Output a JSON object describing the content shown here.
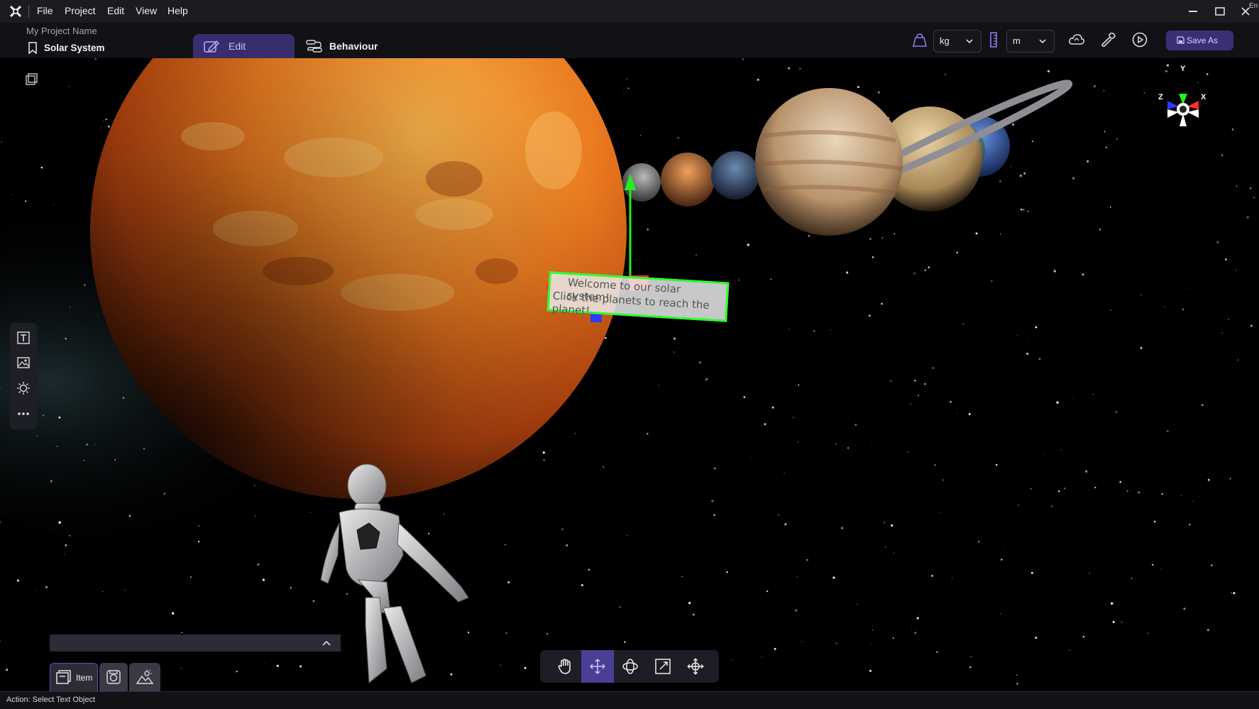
{
  "menu": [
    "File",
    "Project",
    "Edit",
    "View",
    "Help"
  ],
  "header": {
    "project_name": "My Project Name",
    "scene_name": "Solar System",
    "tabs": [
      {
        "label": "Edit",
        "active": true
      },
      {
        "label": "Behaviour",
        "active": false
      }
    ],
    "mass_unit": "kg",
    "length_unit": "m",
    "save_label": "Save As",
    "corner_text": "En"
  },
  "scene": {
    "text_line1": "Welcome to our solar system!",
    "text_line2": "Click the planets to reach the planet!",
    "gizmo": {
      "y": "Y",
      "x": "X",
      "z": "Z"
    }
  },
  "bottom": {
    "item_tab": "Item"
  },
  "status": "Action: Select Text Object",
  "colors": {
    "accent": "#4a3f95",
    "selection": "#2cff2c",
    "axis_x": "#ff3030",
    "axis_y": "#22ee22",
    "axis_z": "#2a3cff"
  }
}
